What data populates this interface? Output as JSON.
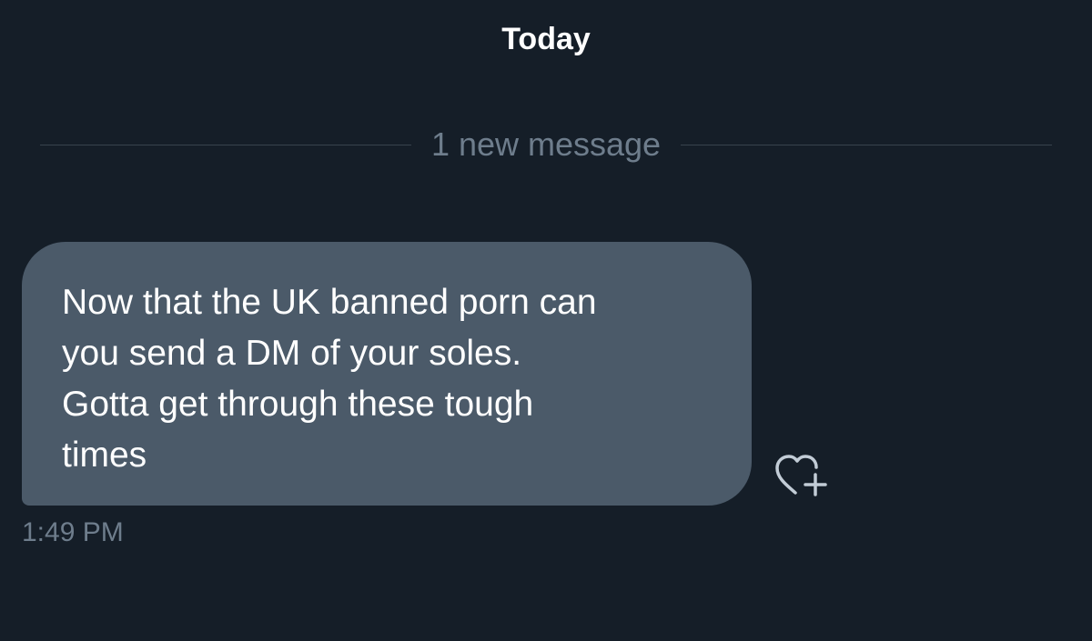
{
  "conversation": {
    "date_heading": "Today",
    "unread_divider": "1 new message",
    "messages": [
      {
        "text": "Now that the UK banned porn can\nyou send a DM of your soles.\nGotta get through these tough\ntimes",
        "time": "1:49 PM",
        "reaction_icon": "heart-plus-icon"
      }
    ]
  },
  "colors": {
    "background": "#151e28",
    "bubble": "#4b5a69",
    "muted_text": "#6e7d8c",
    "divider": "#38444d"
  }
}
